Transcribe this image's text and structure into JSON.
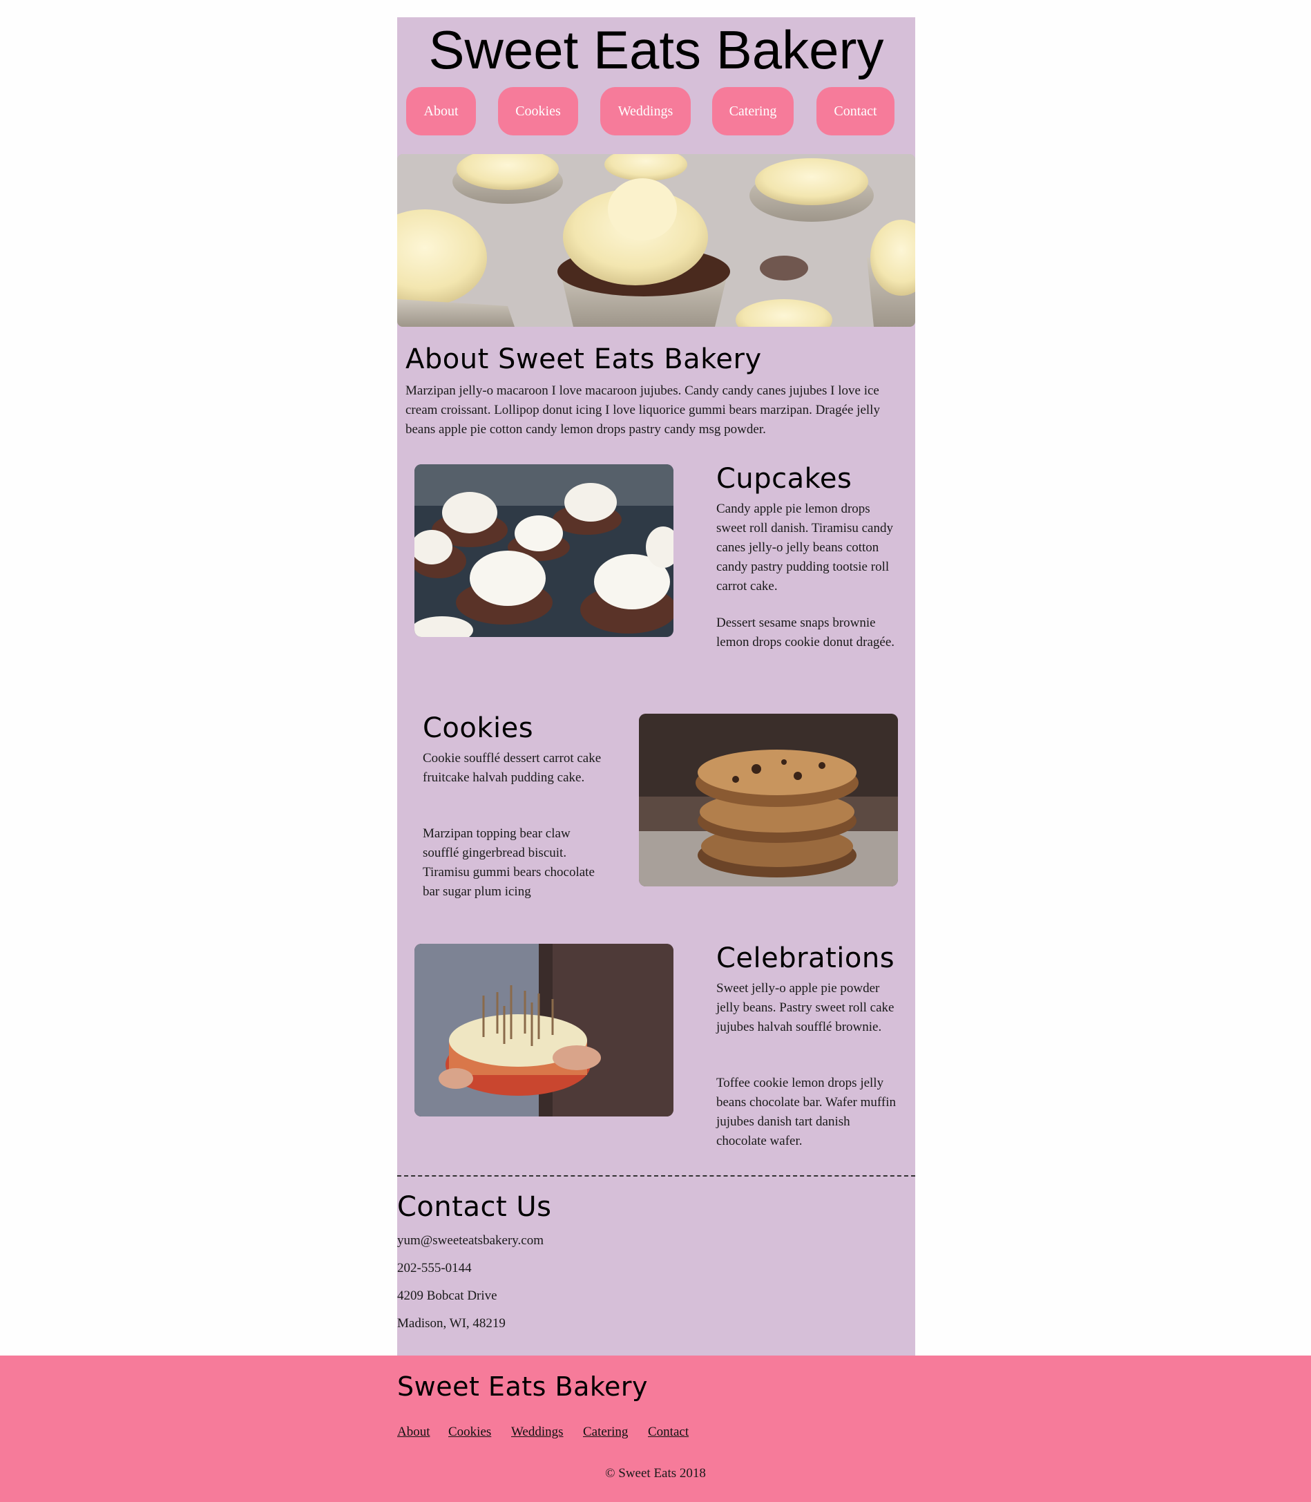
{
  "header": {
    "title": "Sweet Eats Bakery"
  },
  "nav": {
    "about": "About",
    "cookies": "Cookies",
    "weddings": "Weddings",
    "catering": "Catering",
    "contact": "Contact"
  },
  "about": {
    "heading": "About Sweet Eats Bakery",
    "text": "Marzipan jelly-o macaroon I love macaroon jujubes. Candy candy canes jujubes I love ice cream croissant. Lollipop donut icing I love liquorice gummi bears marzipan. Dragée jelly beans apple pie cotton candy lemon drops pastry candy msg powder."
  },
  "cupcakes": {
    "heading": "Cupcakes",
    "p1": "Candy apple pie lemon drops sweet roll danish. Tiramisu candy canes jelly-o jelly beans cotton candy pastry pudding tootsie roll carrot cake.",
    "p2": "Dessert sesame snaps brownie lemon drops cookie donut dragée."
  },
  "cookies": {
    "heading": "Cookies",
    "p1": "Cookie soufflé dessert carrot cake fruitcake halvah pudding cake.",
    "p2": "Marzipan topping bear claw soufflé gingerbread biscuit. Tiramisu gummi bears chocolate bar sugar plum icing"
  },
  "celebrations": {
    "heading": "Celebrations",
    "p1": "Sweet jelly-o apple pie powder jelly beans. Pastry sweet roll cake jujubes halvah soufflé brownie.",
    "p2": "Toffee cookie lemon drops jelly beans chocolate bar. Wafer muffin jujubes danish tart danish chocolate wafer."
  },
  "contact": {
    "heading": "Contact Us",
    "email": "yum@sweeteatsbakery.com",
    "phone": "202-555-0144",
    "street": "4209 Bobcat Drive",
    "city": "Madison, WI, 48219"
  },
  "footer": {
    "brand": "Sweet Eats Bakery",
    "links": {
      "about": "About",
      "cookies": "Cookies",
      "weddings": "Weddings",
      "catering": "Catering",
      "contact": "Contact"
    },
    "copyright": "© Sweet Eats 2018"
  },
  "colors": {
    "page_bg": "#fefefe",
    "content_bg": "#d6bfd8",
    "accent_pink": "#f67b9a"
  }
}
